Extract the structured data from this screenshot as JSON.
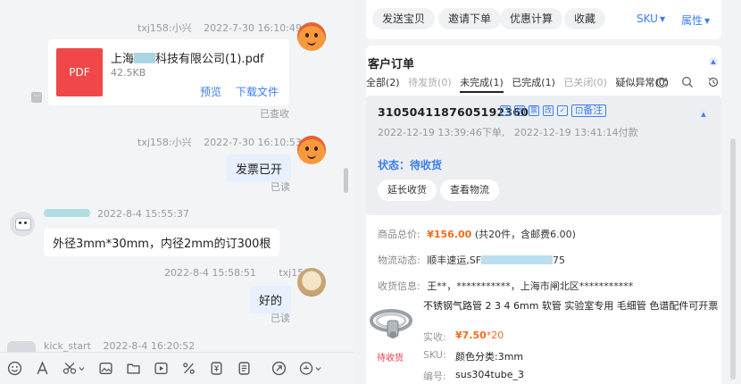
{
  "chat": {
    "messages": [
      {
        "sender": "txj158:小兴",
        "time": "2022-7-30 16:10:49",
        "type": "file",
        "file_name_prefix": "上海",
        "file_name_suffix": "科技有限公司(1).pdf",
        "file_type": "PDF",
        "file_size": "42.5KB",
        "preview_label": "预览",
        "download_label": "下载文件",
        "status": "已查收"
      },
      {
        "sender": "txj158:小兴",
        "time": "2022-7-30 16:10:53",
        "type": "text",
        "text": "发票已开",
        "status": "已读"
      },
      {
        "sender": "",
        "time": "2022-8-4 15:55:37",
        "type": "text",
        "text": "外径3mm*30mm，内径2mm的订300根"
      },
      {
        "sender": "txj158",
        "time": "2022-8-4 15:58:51",
        "type": "text",
        "text": "好的",
        "status": "已读"
      },
      {
        "sender": "kick_start",
        "time": "2022-8-4 16:20:52",
        "type": "text",
        "text": ""
      }
    ],
    "toolbar_icons": [
      "emoji-icon",
      "font-icon",
      "scissors-icon",
      "image-icon",
      "folder-icon",
      "video-icon",
      "discount-icon",
      "coupon-icon",
      "order-icon",
      "share-icon",
      "quick-reply-icon"
    ]
  },
  "actions": {
    "send_baby": "发送宝贝",
    "invite_order": "邀请下单",
    "discount_calc": "优惠计算",
    "favorite": "收藏",
    "sku": "SKU",
    "attribute": "属性"
  },
  "orders": {
    "title": "客户订单",
    "tabs": [
      {
        "label": "全部(2)",
        "state": "normal"
      },
      {
        "label": "待发货(0)",
        "state": "dim"
      },
      {
        "label": "未完成(1)",
        "state": "active"
      },
      {
        "label": "已完成(1)",
        "state": "normal"
      },
      {
        "label": "已关闭(0)",
        "state": "dim"
      },
      {
        "label": "疑似异常(0)",
        "state": "normal"
      }
    ],
    "order": {
      "number": "3105041187605192360",
      "icon_labels": [
        "详",
        "票",
        "改",
        "备注"
      ],
      "created": "2022-12-19 13:39:46下单,",
      "paid": "2022-12-19 13:41:14付款",
      "state_label": "状态：",
      "state_value": "待收货",
      "extend_label": "延长收货",
      "logistics_label": "查看物流",
      "total_label": "商品总价:",
      "total_value": "¥156.00",
      "total_note": "(共20件，含邮费6.00)",
      "logistics_status_label": "物流动态:",
      "logistics_status_value": "顺丰速运,SF",
      "logistics_tail": "75",
      "address_label": "收货信息:",
      "address_value": "王**，***********，上海市闸北区***********",
      "product_title": "不锈钢气路管 2 3 4 6mm 软管 实验室专用 毛细管 色谱配件可开票",
      "paid_label": "实收:",
      "paid_price": "¥7.50",
      "paid_qty": "*20",
      "sku_label": "SKU:",
      "sku_value": "颜色分类:3mm",
      "code_label": "编号:",
      "code_value": "sus304tube_3",
      "pending_label": "待收货"
    }
  },
  "colors": {
    "accent": "#3b7ef0",
    "price": "#f26b1d",
    "pdf": "#f04848",
    "pending": "#e8414d"
  }
}
